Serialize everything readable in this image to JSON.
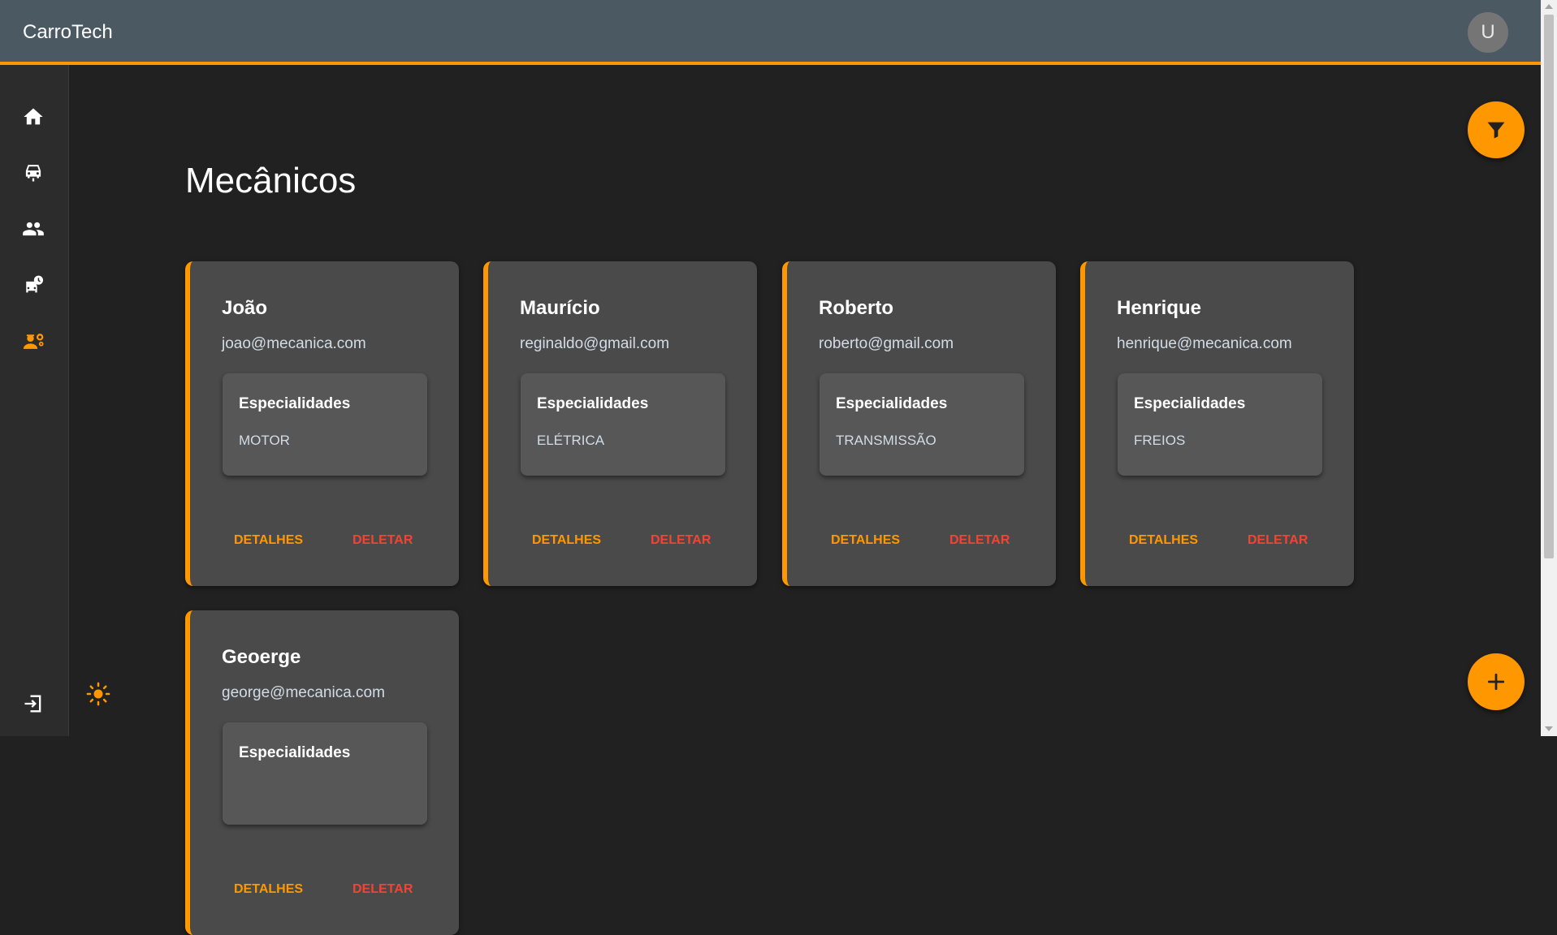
{
  "app": {
    "title": "CarroTech"
  },
  "user": {
    "avatar_initial": "U"
  },
  "sidebar": {
    "items": [
      {
        "name": "home",
        "icon": "home-icon",
        "color": "#ffffff"
      },
      {
        "name": "cars",
        "icon": "car-icon",
        "color": "#ffffff"
      },
      {
        "name": "clients",
        "icon": "people-icon",
        "color": "#ffffff"
      },
      {
        "name": "car-service",
        "icon": "car-clock-icon",
        "color": "#ffffff"
      },
      {
        "name": "mechanics",
        "icon": "mechanic-gear-icon",
        "color": "#ff9800",
        "active": true
      }
    ],
    "logout_icon": "logout-icon",
    "theme_icon": "sun-icon"
  },
  "page": {
    "title": "Mecânicos"
  },
  "mechanics": [
    {
      "name": "João",
      "email": "joao@mecanica.com",
      "specialties_title": "Especialidades",
      "specialty": "MOTOR",
      "details_label": "DETALHES",
      "delete_label": "DELETAR"
    },
    {
      "name": "Maurício",
      "email": "reginaldo@gmail.com",
      "specialties_title": "Especialidades",
      "specialty": "ELÉTRICA",
      "details_label": "DETALHES",
      "delete_label": "DELETAR"
    },
    {
      "name": "Roberto",
      "email": "roberto@gmail.com",
      "specialties_title": "Especialidades",
      "specialty": "TRANSMISSÃO",
      "details_label": "DETALHES",
      "delete_label": "DELETAR"
    },
    {
      "name": "Henrique",
      "email": "henrique@mecanica.com",
      "specialties_title": "Especialidades",
      "specialty": "FREIOS",
      "details_label": "DETALHES",
      "delete_label": "DELETAR"
    },
    {
      "name": "Geoerge",
      "email": "george@mecanica.com",
      "specialties_title": "Especialidades",
      "specialty": "",
      "details_label": "DETALHES",
      "delete_label": "DELETAR"
    }
  ],
  "fabs": {
    "filter_icon": "filter-icon",
    "add_icon": "plus-icon"
  },
  "colors": {
    "accent": "#ff9800",
    "danger": "#f44336",
    "appbar": "#4b5a62",
    "background": "#212121",
    "card": "#4a4a4a"
  }
}
